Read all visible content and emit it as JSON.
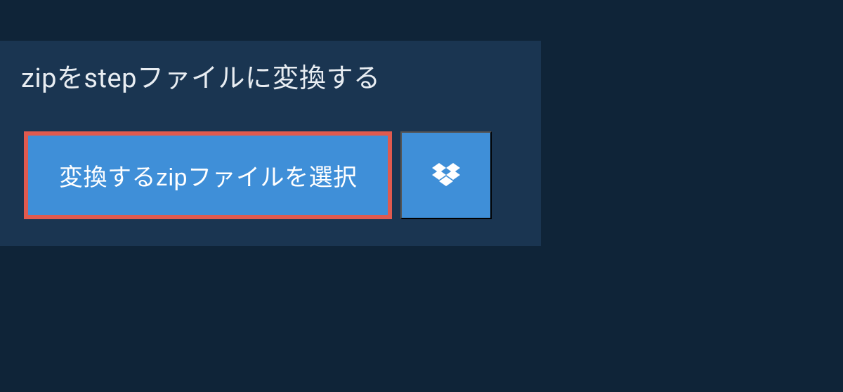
{
  "heading": "zipをstepファイルに変換する",
  "buttons": {
    "select_file_label": "変換するzipファイルを選択"
  },
  "colors": {
    "bg": "#0f2438",
    "panel": "#1a3551",
    "primary": "#3f8fd8",
    "highlight_border": "#e05a4f"
  }
}
